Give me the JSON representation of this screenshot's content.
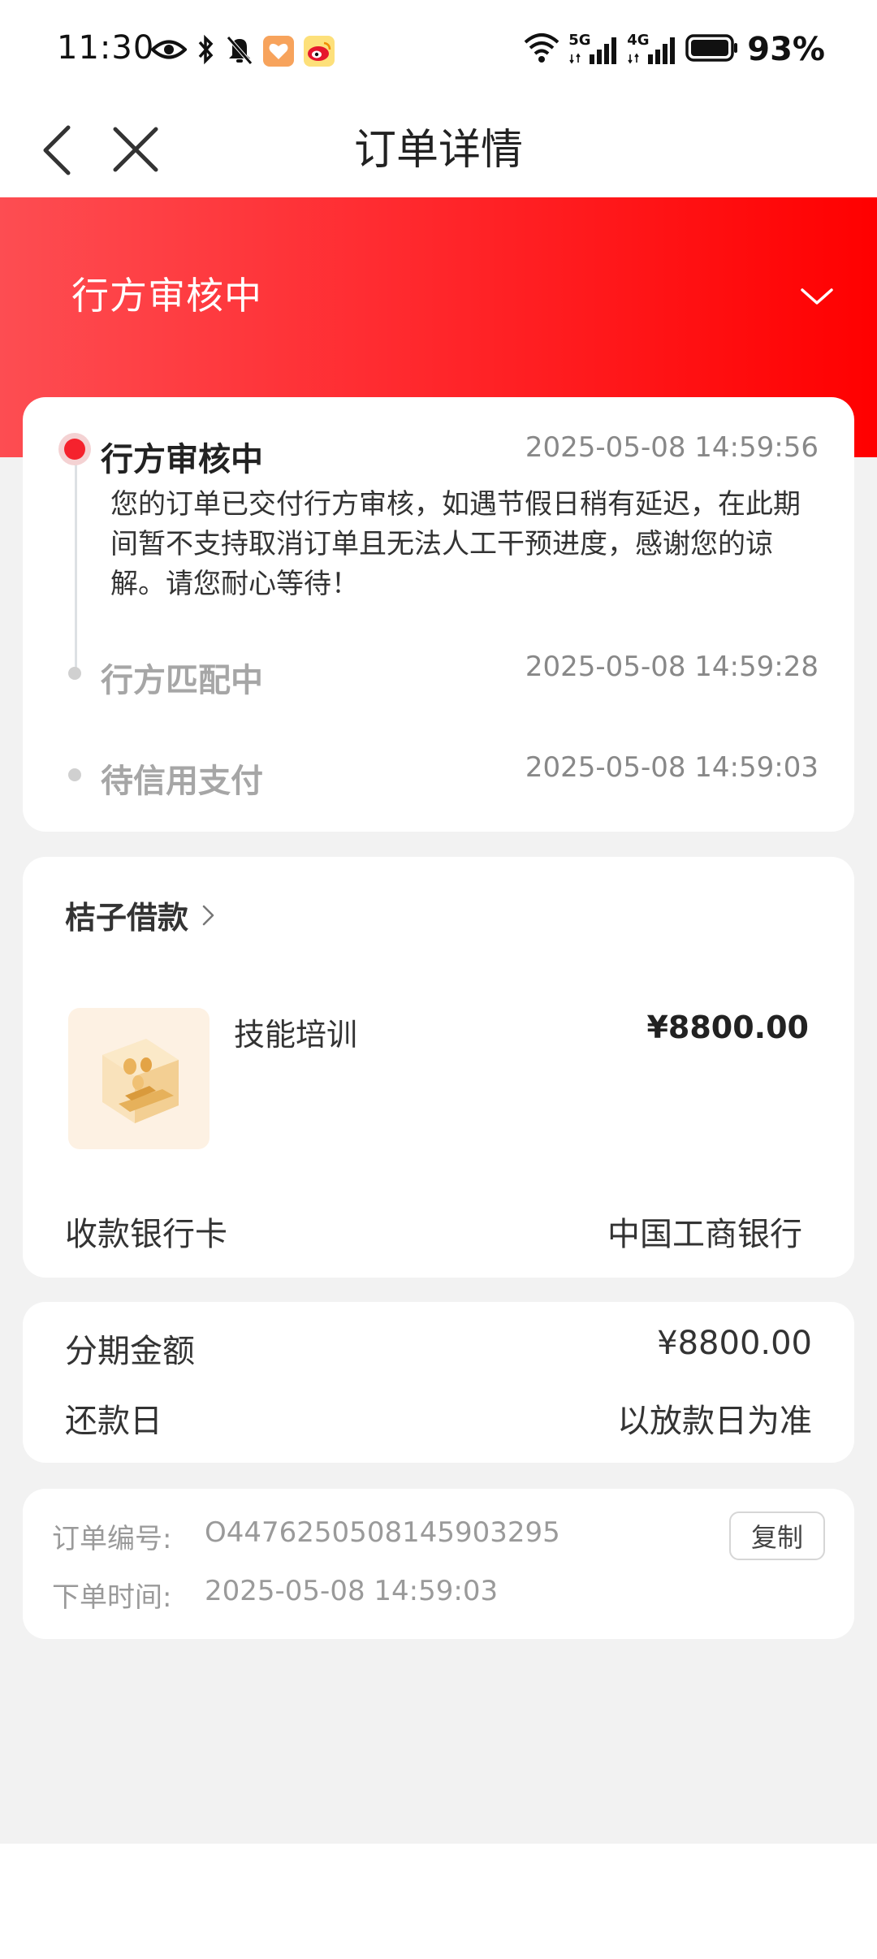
{
  "status_bar": {
    "time": "11:30",
    "battery": "93%",
    "signal_1": "5G",
    "signal_2": "4G",
    "icons_left": [
      "eye-icon",
      "bluetooth-icon",
      "bell-off-icon",
      "app-badge-orange",
      "weibo-icon"
    ],
    "icons_right": [
      "wifi-icon",
      "signal-5g-icon",
      "signal-4g-icon",
      "battery-icon"
    ]
  },
  "nav": {
    "title": "订单详情",
    "back_icon": "chevron-left-icon",
    "close_icon": "close-icon"
  },
  "banner": {
    "title": "行方审核中",
    "toggle_icon": "chevron-down-icon",
    "gradient": [
      "#fd4d52",
      "#ff0000"
    ]
  },
  "timeline": [
    {
      "title": "行方审核中",
      "time": "2025-05-08 14:59:56",
      "state": "active",
      "description": "您的订单已交付行方审核，如遇节假日稍有延迟，在此期间暂不支持取消订单且无法人工干预进度，感谢您的谅解。请您耐心等待！"
    },
    {
      "title": "行方匹配中",
      "time": "2025-05-08 14:59:28",
      "state": "done"
    },
    {
      "title": "待信用支付",
      "time": "2025-05-08 14:59:03",
      "state": "done"
    }
  ],
  "order": {
    "shop_name": "桔子借款",
    "product": {
      "name": "技能培训",
      "price": "¥8800.00",
      "image_icon": "gold-coin-box-icon"
    },
    "bank_label": "收款银行卡",
    "bank_value": "中国工商银行"
  },
  "installment": {
    "amount_label": "分期金额",
    "amount_value": "¥8800.00",
    "repay_label": "还款日",
    "repay_value": "以放款日为准"
  },
  "meta": {
    "order_no_label": "订单编号:",
    "order_no_value": "O447625050814590329​5",
    "order_time_label": "下单时间:",
    "order_time_value": "2025-05-08 14:59:03",
    "copy_label": "复制"
  },
  "colors": {
    "accent_red": "#f5222d",
    "page_bg": "#f2f2f2"
  }
}
